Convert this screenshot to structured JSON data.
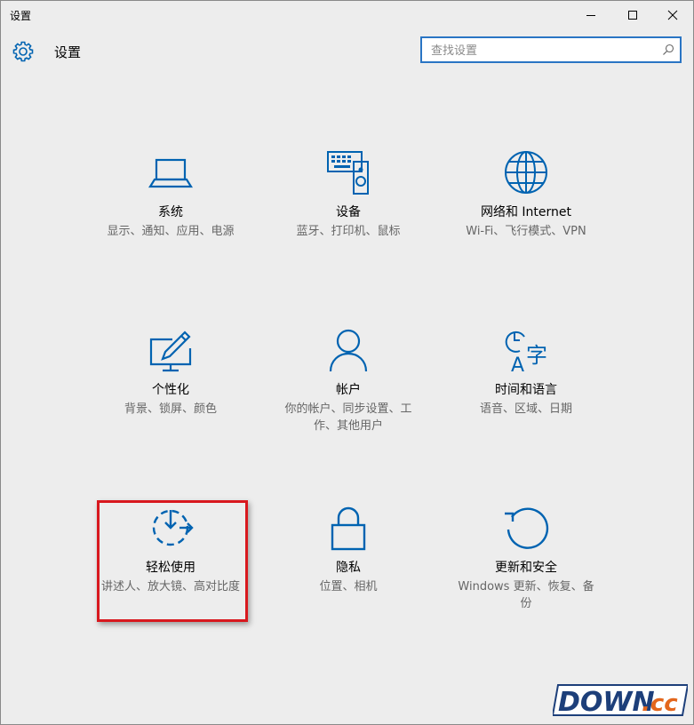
{
  "window": {
    "title": "设置",
    "accent": "#0063b1"
  },
  "header": {
    "gear_icon": "gear-icon",
    "title": "设置"
  },
  "search": {
    "placeholder": "查找设置",
    "value": ""
  },
  "tiles": [
    {
      "name": "系统",
      "desc": "显示、通知、应用、电源",
      "icon": "laptop-icon"
    },
    {
      "name": "设备",
      "desc": "蓝牙、打印机、鼠标",
      "icon": "devices-icon"
    },
    {
      "name": "网络和 Internet",
      "desc": "Wi-Fi、飞行模式、VPN",
      "icon": "globe-icon"
    },
    {
      "name": "个性化",
      "desc": "背景、锁屏、颜色",
      "icon": "personalization-icon"
    },
    {
      "name": "帐户",
      "desc": "你的帐户、同步设置、工作、其他用户",
      "icon": "person-icon"
    },
    {
      "name": "时间和语言",
      "desc": "语音、区域、日期",
      "icon": "time-language-icon"
    },
    {
      "name": "轻松使用",
      "desc": "讲述人、放大镜、高对比度",
      "icon": "ease-of-access-icon"
    },
    {
      "name": "隐私",
      "desc": "位置、相机",
      "icon": "lock-icon"
    },
    {
      "name": "更新和安全",
      "desc": "Windows 更新、恢复、备份",
      "icon": "update-icon"
    }
  ],
  "highlight_color": "#d8181e",
  "watermark": {
    "text_main": "DOWN",
    "text_suffix": ".cc"
  }
}
